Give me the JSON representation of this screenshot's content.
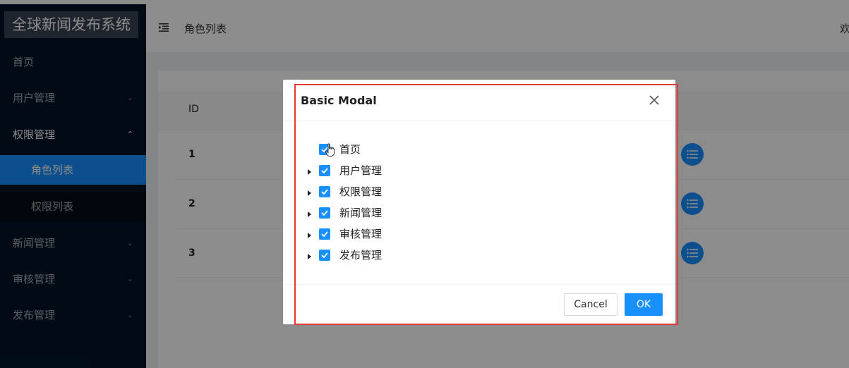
{
  "app": {
    "title": "全球新闻发布系统"
  },
  "sidebar": {
    "items": [
      {
        "label": "首页"
      },
      {
        "label": "用户管理"
      },
      {
        "label": "权限管理"
      },
      {
        "label": "角色列表"
      },
      {
        "label": "权限列表"
      },
      {
        "label": "新闻管理"
      },
      {
        "label": "审核管理"
      },
      {
        "label": "发布管理"
      }
    ]
  },
  "header": {
    "title": "角色列表",
    "right_text": "欢"
  },
  "table": {
    "column_id": "ID",
    "rows": [
      {
        "id": "1"
      },
      {
        "id": "2"
      },
      {
        "id": "3"
      }
    ]
  },
  "modal": {
    "title": "Basic Modal",
    "tree": [
      {
        "label": "首页"
      },
      {
        "label": "用户管理"
      },
      {
        "label": "权限管理"
      },
      {
        "label": "新闻管理"
      },
      {
        "label": "审核管理"
      },
      {
        "label": "发布管理"
      }
    ],
    "cancel_label": "Cancel",
    "ok_label": "OK"
  },
  "colors": {
    "primary": "#1890ff",
    "sidebar": "#001529",
    "highlight": "#e53935"
  }
}
